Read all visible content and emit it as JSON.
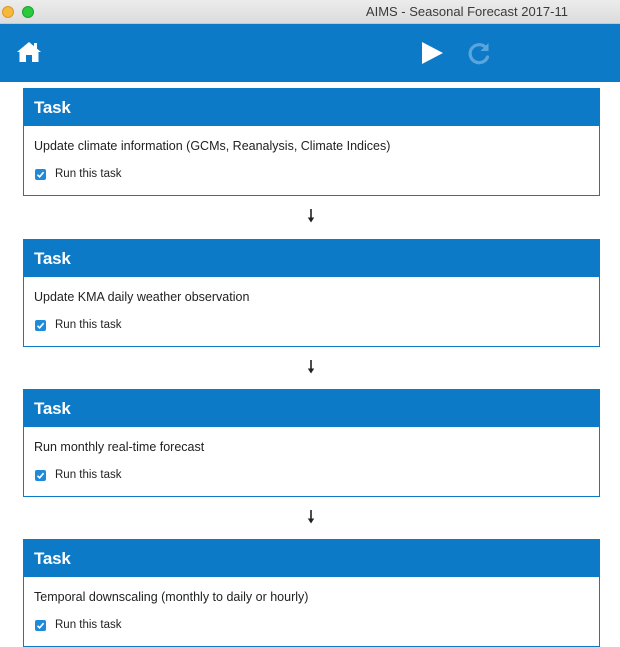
{
  "window": {
    "title": "AIMS - Seasonal Forecast 2017-11"
  },
  "toolbar": {
    "home_icon": "home-icon",
    "run_icon": "play-icon",
    "refresh_icon": "refresh-icon"
  },
  "colors": {
    "accent": "#0d7ac8",
    "checkbox": "#1f8ad9",
    "refresh_disabled": "#5aa6dc"
  },
  "tasks": [
    {
      "header": "Task",
      "description": "Update climate information (GCMs, Reanalysis, Climate Indices)",
      "checkbox_label": "Run this task",
      "checked": true
    },
    {
      "header": "Task",
      "description": "Update KMA daily weather observation",
      "checkbox_label": "Run this task",
      "checked": true
    },
    {
      "header": "Task",
      "description": "Run monthly real-time forecast",
      "checkbox_label": "Run this task",
      "checked": true
    },
    {
      "header": "Task",
      "description": "Temporal downscaling (monthly to daily or hourly)",
      "checkbox_label": "Run this task",
      "checked": true
    }
  ]
}
